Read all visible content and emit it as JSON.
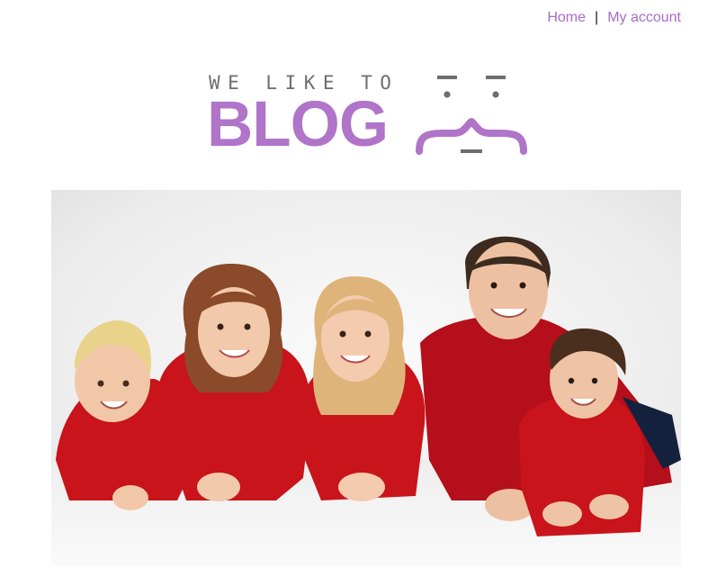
{
  "nav": {
    "home_label": "Home",
    "separator": "|",
    "account_label": "My account"
  },
  "logo": {
    "tagline": "WE LIKE TO",
    "wordmark": "BLOG"
  },
  "colors": {
    "brand_purple": "#b074c9",
    "link_purple": "#a96bc6",
    "tagline_gray": "#6e6e6e",
    "clothing_red": "#c8141a"
  },
  "hero": {
    "subject": "family-photo-image"
  }
}
